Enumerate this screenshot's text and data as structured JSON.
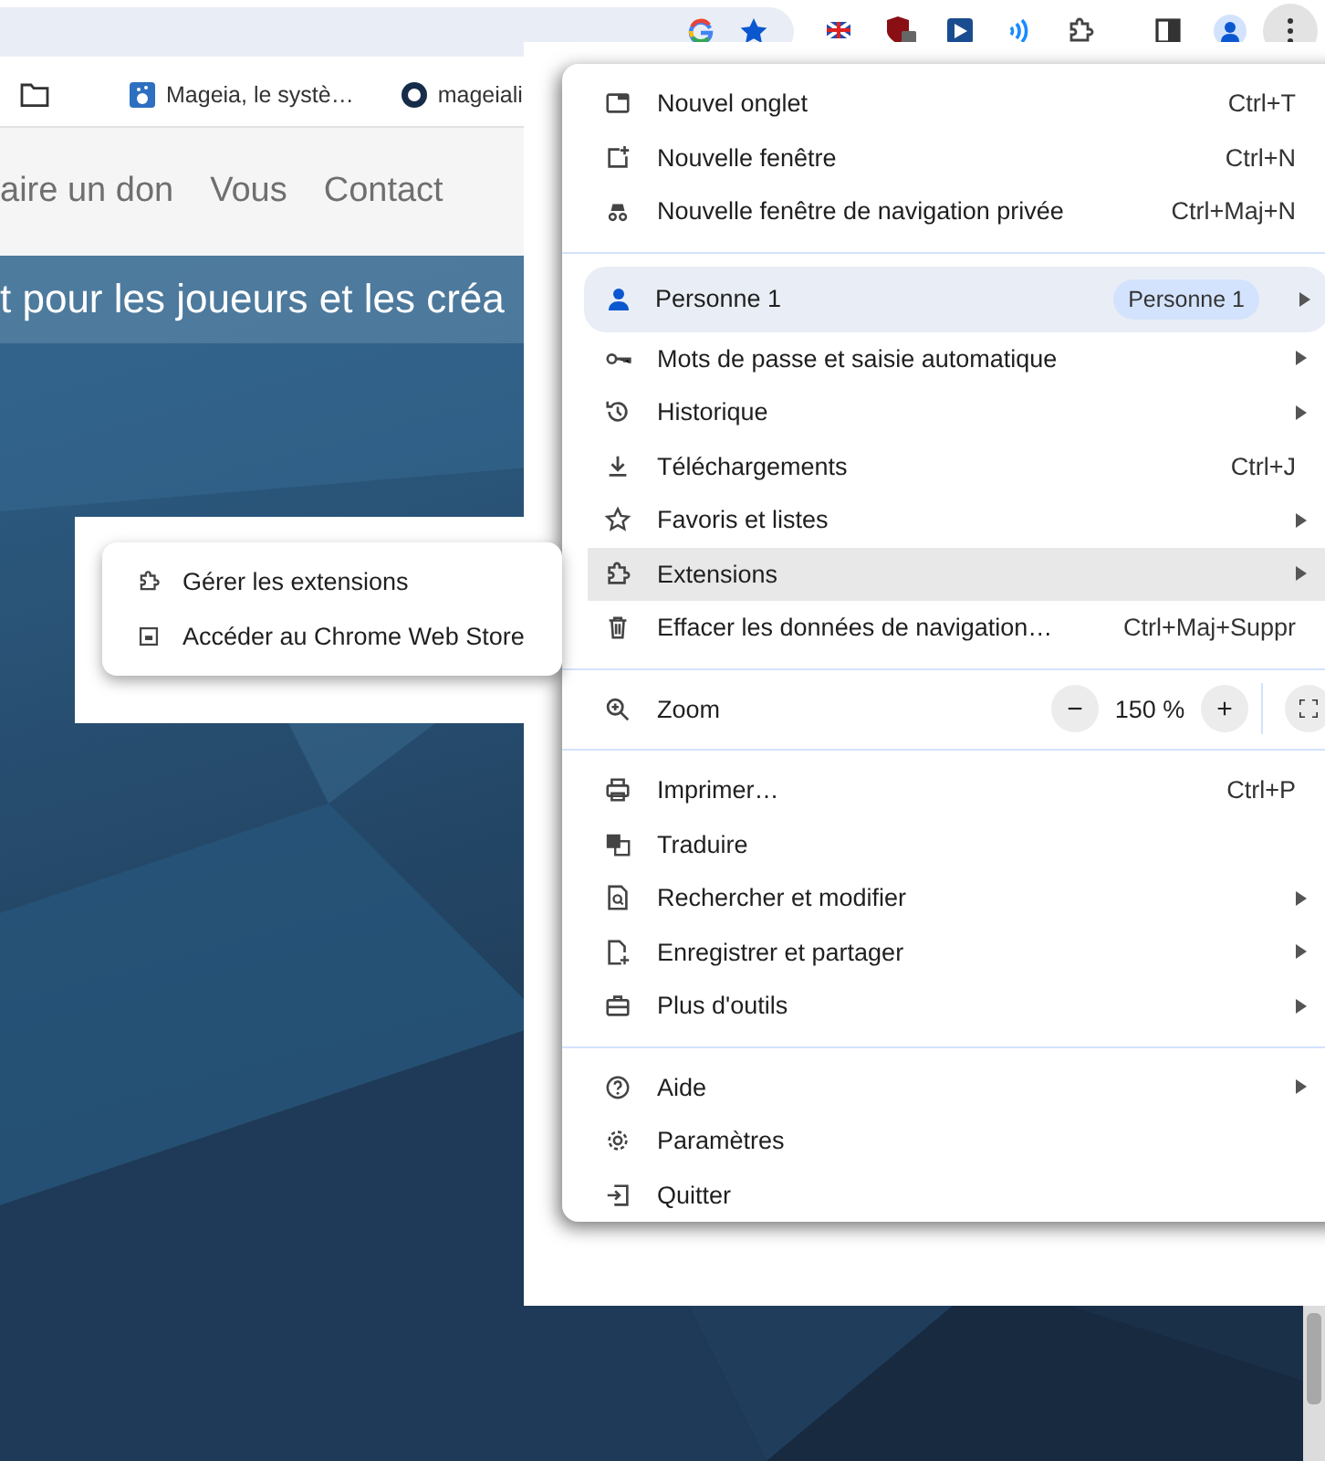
{
  "bookmarks": [
    {
      "label": "Mageia, le systè…"
    },
    {
      "label": "mageiali"
    }
  ],
  "site_nav": [
    "aire un don",
    "Vous",
    "Contact"
  ],
  "hero_text": "t pour les joueurs et les créa",
  "menu": {
    "sections": [
      [
        {
          "kind": "item",
          "label": "Nouvel onglet",
          "shortcut": "Ctrl+T",
          "submenu": false,
          "selected": false
        },
        {
          "kind": "item",
          "label": "Nouvelle fenêtre",
          "shortcut": "Ctrl+N",
          "submenu": false,
          "selected": false
        },
        {
          "kind": "item",
          "label": "Nouvelle fenêtre de navigation privée",
          "shortcut": "Ctrl+Maj+N",
          "submenu": false,
          "selected": false
        }
      ],
      [
        {
          "kind": "profile",
          "label": "Personne 1",
          "badge": "Personne 1",
          "submenu": true,
          "selected": false
        },
        {
          "kind": "item",
          "label": "Mots de passe et saisie automatique",
          "submenu": true,
          "selected": false
        },
        {
          "kind": "item",
          "label": "Historique",
          "submenu": true,
          "selected": false
        },
        {
          "kind": "item",
          "label": "Téléchargements",
          "shortcut": "Ctrl+J",
          "submenu": false,
          "selected": false
        },
        {
          "kind": "item",
          "label": "Favoris et listes",
          "submenu": true,
          "selected": false
        },
        {
          "kind": "item",
          "label": "Extensions",
          "submenu": true,
          "selected": true
        },
        {
          "kind": "item",
          "label": "Effacer les données de navigation…",
          "shortcut": "Ctrl+Maj+Suppr",
          "submenu": false,
          "selected": false
        }
      ],
      [
        {
          "kind": "zoom",
          "label": "Zoom",
          "minus": "−",
          "value": "150 %",
          "plus": "+"
        }
      ],
      [
        {
          "kind": "item",
          "label": "Imprimer…",
          "shortcut": "Ctrl+P",
          "submenu": false,
          "selected": false
        },
        {
          "kind": "item",
          "label": "Traduire",
          "submenu": false,
          "selected": false
        },
        {
          "kind": "item",
          "label": "Rechercher et modifier",
          "submenu": true,
          "selected": false
        },
        {
          "kind": "item",
          "label": "Enregistrer et partager",
          "submenu": true,
          "selected": false
        },
        {
          "kind": "item",
          "label": "Plus d'outils",
          "submenu": true,
          "selected": false
        }
      ],
      [
        {
          "kind": "item",
          "label": "Aide",
          "submenu": true,
          "selected": false
        },
        {
          "kind": "item",
          "label": "Paramètres",
          "submenu": false,
          "selected": false
        },
        {
          "kind": "item",
          "label": "Quitter",
          "submenu": false,
          "selected": false
        }
      ]
    ]
  },
  "submenu": [
    {
      "label": "Gérer les extensions"
    },
    {
      "label": "Accéder au Chrome Web Store"
    }
  ]
}
